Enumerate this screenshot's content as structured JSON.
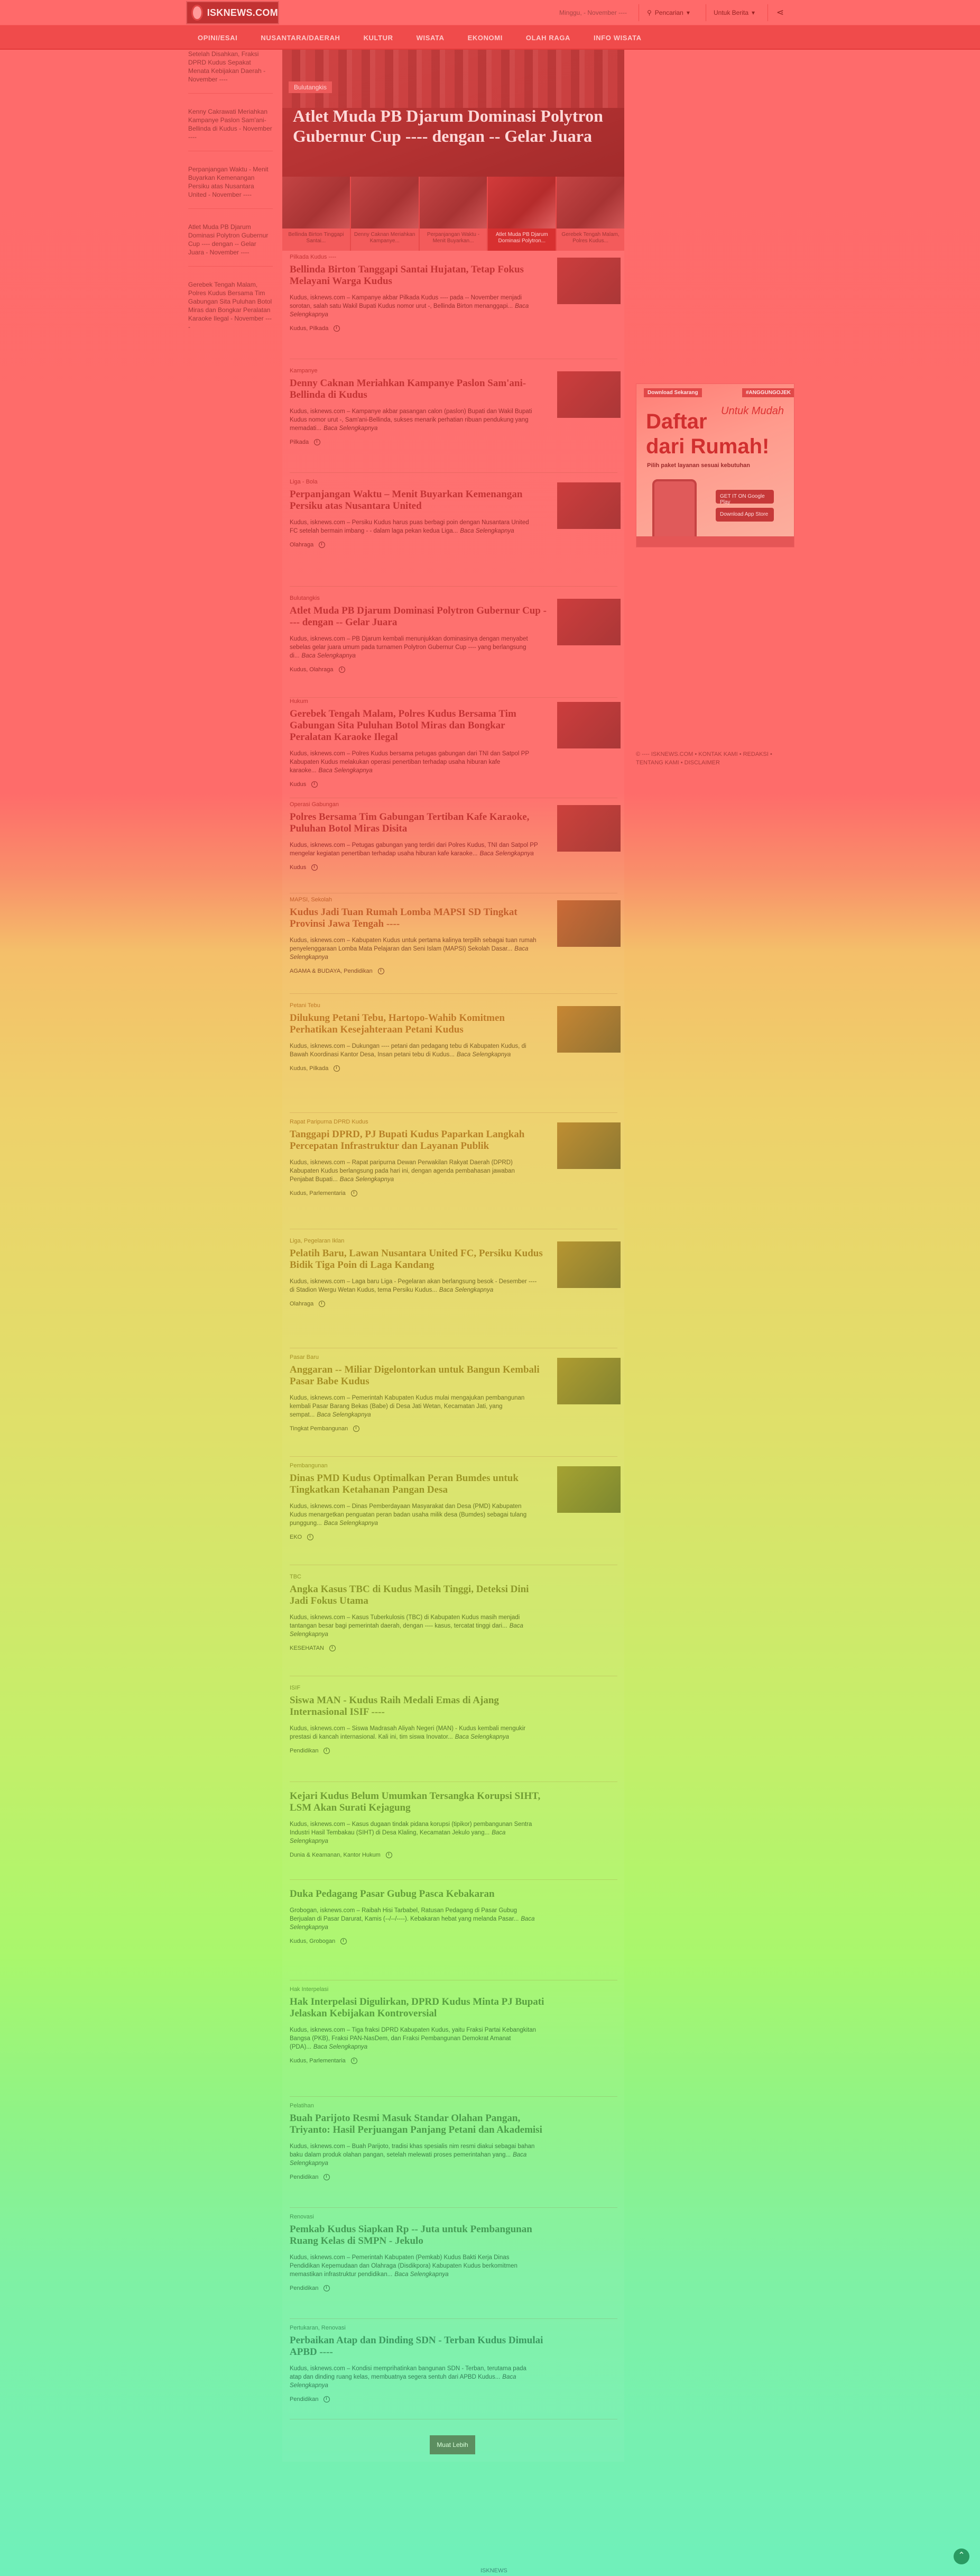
{
  "header": {
    "logo_text": "ISKNEWS.COM",
    "date": "Minggu, - November ----",
    "menu1": "Pencarian",
    "menu2": "Untuk Berita",
    "nav": [
      "Opini/Esai",
      "Nusantara/Daerah",
      "Kultur",
      "Wisata",
      "Ekonomi",
      "Olah Raga",
      "Info Wisata"
    ]
  },
  "left_list": [
    "Setelah Disahkan, Fraksi DPRD Kudus Sepakat Menata Kebijakan Daerah - November ----",
    "Kenny Cakrawati Meriahkan Kampanye Paslon Sam'ani-Bellinda di Kudus - November ----",
    "Perpanjangan Waktu - Menit Buyarkan Kemenangan Persiku atas Nusantara United - November ----",
    "Atlet Muda PB Djarum Dominasi Polytron Gubernur Cup ---- dengan -- Gelar Juara - November ----",
    "Gerebek Tengah Malam, Polres Kudus Bersama Tim Gabungan Sita Puluhan Botol Miras dan Bongkar Peralatan Karaoke Ilegal - November ----"
  ],
  "hero": {
    "tag": "Bulutangkis",
    "title": "Atlet Muda PB Djarum Dominasi Polytron Gubernur Cup ---- dengan -- Gelar Juara"
  },
  "thumbs": [
    "Bellinda Birton Tinggapi Santai...",
    "Denny Caknan Meriahkan Kampanye...",
    "Perpanjangan Waktu - Menit Buyarkan...",
    "Atlet Muda PB Djarum Dominasi Polytron...",
    "Gerebek Tengah Malam, Polres Kudus..."
  ],
  "articles": [
    {
      "cat": "Pilkada Kudus ----",
      "title": "Bellinda Birton Tanggapi Santai Hujatan, Tetap Fokus Melayani Warga Kudus",
      "excerpt": "Kudus, isknews.com – Kampanye akbar Pilkada Kudus ---- pada -- November menjadi sorotan, salah satu Wakil Bupati Kudus nomor urut -, Bellinda Birton menanggapi...",
      "more": "Baca Selengkapnya",
      "meta": "Kudus, Pilkada"
    },
    {
      "cat": "Kampanye",
      "title": "Denny Caknan Meriahkan Kampanye Paslon Sam'ani-Bellinda di Kudus",
      "excerpt": "Kudus, isknews.com – Kampanye akbar pasangan calon (paslon) Bupati dan Wakil Bupati Kudus nomor urut -, Sam'ani-Bellinda, sukses menarik perhatian ribuan pendukung yang memadati...",
      "more": "Baca Selengkapnya",
      "meta": "Pilkada"
    },
    {
      "cat": "Liga - Bola",
      "title": "Perpanjangan Waktu – Menit Buyarkan Kemenangan Persiku atas Nusantara United",
      "excerpt": "Kudus, isknews.com – Persiku Kudus harus puas berbagi poin dengan Nusantara United FC setelah bermain imbang - - dalam laga pekan kedua Liga...",
      "more": "Baca Selengkapnya",
      "meta": "Olahraga"
    },
    {
      "cat": "Bulutangkis",
      "title": "Atlet Muda PB Djarum Dominasi Polytron Gubernur Cup ---- dengan -- Gelar Juara",
      "excerpt": "Kudus, isknews.com – PB Djarum kembali menunjukkan dominasinya dengan menyabet sebelas gelar juara umum pada turnamen Polytron Gubernur Cup ---- yang berlangsung di...",
      "more": "Baca Selengkapnya",
      "meta": "Kudus, Olahraga"
    },
    {
      "cat": "Hukum",
      "title": "Gerebek Tengah Malam, Polres Kudus Bersama Tim Gabungan Sita Puluhan Botol Miras dan Bongkar Peralatan Karaoke Ilegal",
      "excerpt": "Kudus, isknews.com – Polres Kudus bersama petugas gabungan dari TNI dan Satpol PP Kabupaten Kudus melakukan operasi penertiban terhadap usaha hiburan kafe karaoke...",
      "more": "Baca Selengkapnya",
      "meta": "Kudus"
    },
    {
      "cat": "Operasi Gabungan",
      "title": "Polres Bersama Tim Gabungan Tertiban Kafe Karaoke, Puluhan Botol Miras Disita",
      "excerpt": "Kudus, isknews.com – Petugas gabungan yang terdiri dari Polres Kudus, TNI dan Satpol PP mengelar kegiatan penertiban terhadap usaha hiburan kafe karaoke...",
      "more": "Baca Selengkapnya",
      "meta": "Kudus"
    },
    {
      "cat": "MAPSI, Sekolah",
      "title": "Kudus Jadi Tuan Rumah Lomba MAPSI SD Tingkat Provinsi Jawa Tengah ----",
      "excerpt": "Kudus, isknews.com – Kabupaten Kudus untuk pertama kalinya terpilih sebagai tuan rumah penyelenggaraan Lomba Mata Pelajaran dan Seni Islam (MAPSI) Sekolah Dasar...",
      "more": "Baca Selengkapnya",
      "meta": "AGAMA & BUDAYA, Pendidikan"
    },
    {
      "cat": "Petani Tebu",
      "title": "Dilukung Petani Tebu, Hartopo-Wahib Komitmen Perhatikan Kesejahteraan Petani Kudus",
      "excerpt": "Kudus, isknews.com – Dukungan ---- petani dan pedagang tebu di Kabupaten Kudus, di Bawah Koordinasi Kantor Desa, Insan petani tebu di Kudus...",
      "more": "Baca Selengkapnya",
      "meta": "Kudus, Pilkada"
    },
    {
      "cat": "Rapat Paripurna DPRD Kudus",
      "title": "Tanggapi DPRD, PJ Bupati Kudus Paparkan Langkah Percepatan Infrastruktur dan Layanan Publik",
      "excerpt": "Kudus, isknews.com – Rapat paripurna Dewan Perwakilan Rakyat Daerah (DPRD) Kabupaten Kudus berlangsung pada hari ini, dengan agenda pembahasan jawaban Penjabat Bupati...",
      "more": "Baca Selengkapnya",
      "meta": "Kudus, Parlementaria"
    },
    {
      "cat": "Liga, Pegelaran Iklan",
      "title": "Pelatih Baru, Lawan Nusantara United FC, Persiku Kudus Bidik Tiga Poin di Laga Kandang",
      "excerpt": "Kudus, isknews.com – Laga baru Liga - Pegelaran akan berlangsung besok - Desember ---- di Stadion Wergu Wetan Kudus, tema Persiku Kudus...",
      "more": "Baca Selengkapnya",
      "meta": "Olahraga"
    },
    {
      "cat": "Pasar Baru",
      "title": "Anggaran -- Miliar Digelontorkan untuk Bangun Kembali Pasar Babe Kudus",
      "excerpt": "Kudus, isknews.com – Pemerintah Kabupaten Kudus mulai mengajukan pembangunan kembali Pasar Barang Bekas (Babe) di Desa Jati Wetan, Kecamatan Jati, yang sempat...",
      "more": "Baca Selengkapnya",
      "meta": "Tingkat Pembangunan"
    },
    {
      "cat": "Pembangunan",
      "title": "Dinas PMD Kudus Optimalkan Peran Bumdes untuk Tingkatkan Ketahanan Pangan Desa",
      "excerpt": "Kudus, isknews.com – Dinas Pemberdayaan Masyarakat dan Desa (PMD) Kabupaten Kudus menargetkan penguatan peran badan usaha milik desa (Bumdes) sebagai tulang punggung...",
      "more": "Baca Selengkapnya",
      "meta": "EKO"
    },
    {
      "cat": "TBC",
      "title": "Angka Kasus TBC di Kudus Masih Tinggi, Deteksi Dini Jadi Fokus Utama",
      "excerpt": "Kudus, isknews.com – Kasus Tuberkulosis (TBC) di Kabupaten Kudus masih menjadi tantangan besar bagi pemerintah daerah, dengan ---- kasus, tercatat tinggi dari...",
      "more": "Baca Selengkapnya",
      "meta": "KESEHATAN"
    },
    {
      "cat": "ISIF",
      "title": "Siswa MAN - Kudus Raih Medali Emas di Ajang Internasional ISIF ----",
      "excerpt": "Kudus, isknews.com – Siswa Madrasah Aliyah Negeri (MAN) - Kudus kembali mengukir prestasi di kancah internasional. Kali ini, tim siswa Inovator...",
      "more": "Baca Selengkapnya",
      "meta": "Pendidikan"
    },
    {
      "cat": "",
      "title": "Kejari Kudus Belum Umumkan Tersangka Korupsi SIHT, LSM Akan Surati Kejagung",
      "excerpt": "Kudus, isknews.com – Kasus dugaan tindak pidana korupsi (tipikor) pembangunan Sentra Industri Hasil Tembakau (SIHT) di Desa Klaling, Kecamatan Jekulo yang...",
      "more": "Baca Selengkapnya",
      "meta": "Dunia & Keamanan, Kantor Hukum"
    },
    {
      "cat": "",
      "title": "Duka Pedagang Pasar Gubug Pasca Kebakaran",
      "excerpt": "Grobogan, isknews.com – Raibah Hisi Tarbabel, Ratusan Pedagang di Pasar Gubug Berjualan di Pasar Darurat, Kamis (--/--/----). Kebakaran hebat yang melanda Pasar...",
      "more": "Baca Selengkapnya",
      "meta": "Kudus, Grobogan"
    },
    {
      "cat": "Hak Interpelasi",
      "title": "Hak Interpelasi Digulirkan, DPRD Kudus Minta PJ Bupati Jelaskan Kebijakan Kontroversial",
      "excerpt": "Kudus, isknews.com – Tiga fraksi DPRD Kabupaten Kudus, yaitu Fraksi Partai Kebangkitan Bangsa (PKB), Fraksi PAN-NasDem, dan Fraksi Pembangunan Demokrat Amanat (PDA)...",
      "more": "Baca Selengkapnya",
      "meta": "Kudus, Parlementaria"
    },
    {
      "cat": "Pelatihan",
      "title": "Buah Parijoto Resmi Masuk Standar Olahan Pangan, Triyanto: Hasil Perjuangan Panjang Petani dan Akademisi",
      "excerpt": "Kudus, isknews.com – Buah Parijoto, tradisi khas spesialis nim resmi diakui sebagai bahan baku dalam produk olahan pangan, setelah melewati proses pemerintahan yang...",
      "more": "Baca Selengkapnya",
      "meta": "Pendidikan"
    },
    {
      "cat": "Renovasi",
      "title": "Pemkab Kudus Siapkan Rp -- Juta untuk Pembangunan Ruang Kelas di SMPN - Jekulo",
      "excerpt": "Kudus, isknews.com – Pemerintah Kabupaten (Pemkab) Kudus Bakti Kerja Dinas Pendidikan Kepemudaan dan Olahraga (Disdikpora) Kabupaten Kudus berkomitmen memastikan infrastruktur pendidikan...",
      "more": "Baca Selengkapnya",
      "meta": "Pendidikan"
    },
    {
      "cat": "Pertukaran, Renovasi",
      "title": "Perbaikan Atap dan Dinding SDN - Terban Kudus Dimulai APBD ----",
      "excerpt": "Kudus, isknews.com – Kondisi memprihatinkan bangunan SDN - Terban, terutama pada atap dan dinding ruang kelas, membuatnya segera sentuh dari APBD Kudus...",
      "more": "Baca Selengkapnya",
      "meta": "Pendidikan"
    }
  ],
  "more_button": "Muat Lebih",
  "ad": {
    "badge_left": "Download Sekarang",
    "badge_right": "#ANGGUNGOJEK",
    "script": "Untuk Mudah",
    "line1": "Daftar",
    "line2": "dari Rumah!",
    "sub": "Pilih paket layanan sesuai kebutuhan",
    "store1": "GET IT ON Google Play",
    "store2": "Download App Store"
  },
  "footer_right": "© ---- ISKNEWS.COM  •  KONTAK KAMI  •  REDAKSI  •  TENTANG KAMI  •  DISCLAIMER",
  "bottom_center": "ISKNEWS",
  "colors": {
    "accent": "#f04b4b",
    "button": "#5c8e60"
  }
}
